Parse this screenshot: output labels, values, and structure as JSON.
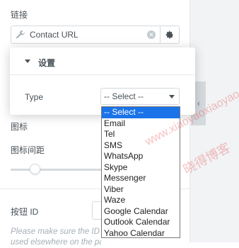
{
  "link": {
    "label": "链接",
    "url_text": "Contact URL",
    "icons": [
      "wrench-icon",
      "clear-icon",
      "gear-icon"
    ]
  },
  "popover": {
    "title": "设置",
    "type_label": "Type",
    "selected_value": "-- Select --"
  },
  "dropdown": {
    "options": [
      "-- Select --",
      "Email",
      "Tel",
      "SMS",
      "WhatsApp",
      "Skype",
      "Messenger",
      "Viber",
      "Waze",
      "Google Calendar",
      "Outlook Calendar",
      "Yahoo Calendar"
    ],
    "highlighted_index": 0
  },
  "fields": {
    "icon_label": "图标",
    "icon_spacing_label": "图标间距",
    "spacing_slider_value": 0.2,
    "button_id_label": "按钮 ID",
    "note_line1": "Please make sure the ID",
    "note_line2": "used elsewhere on the page this form is"
  },
  "watermark": {
    "text1": "www.xiaoyaoxiaoyao.com",
    "text2": "晓得博客"
  },
  "colors": {
    "accent": "#1a73e8",
    "border": "#d5dadf",
    "text": "#495157",
    "muted": "#a4afb7",
    "watermark": "#e94e4e"
  }
}
